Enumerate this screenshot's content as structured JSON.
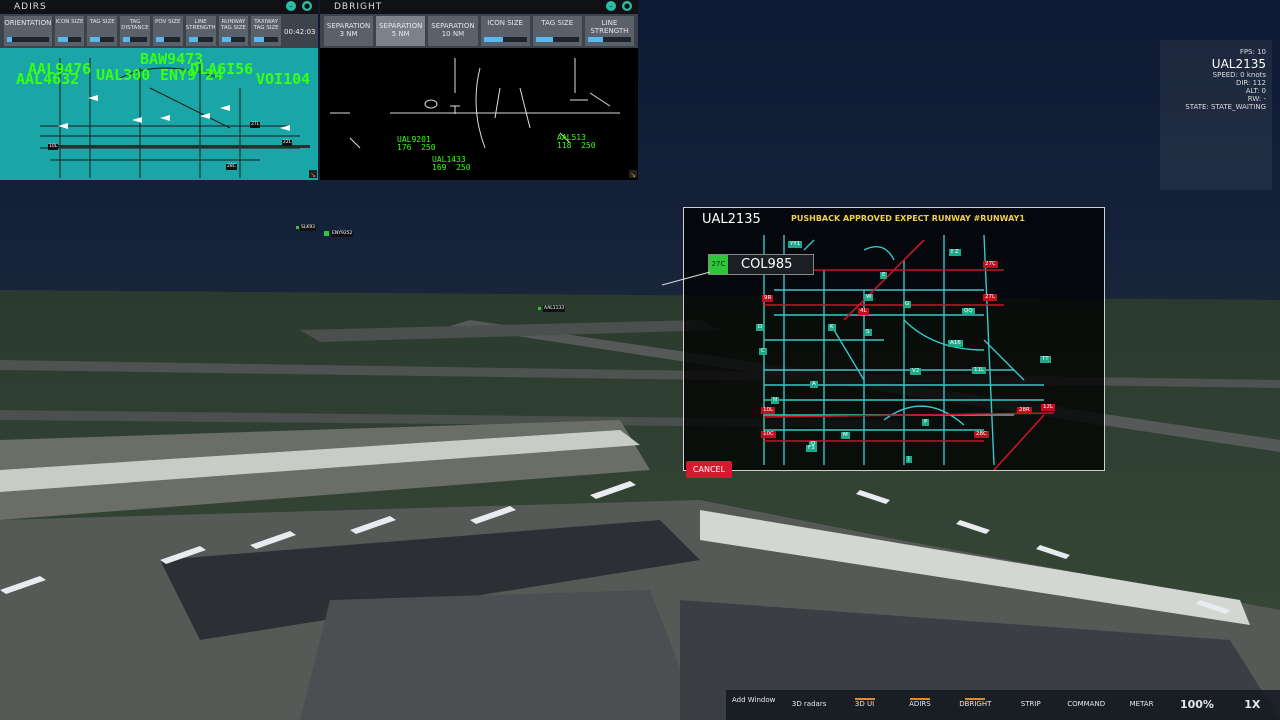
{
  "adirs": {
    "title": "ADIRS",
    "toolbar": [
      "ORIENTATION",
      "ICON SIZE",
      "TAG SIZE",
      "TAG DISTANCE",
      "POV SIZE",
      "LINE STRENGTH",
      "RUNWAY TAG SIZE",
      "TAXIWAY TAG SIZE"
    ],
    "clock": "00:42:03",
    "map_labels": {
      "a": "AAL9476",
      "b": "AAL4632",
      "c": "BAW9473",
      "d": "UAL300",
      "e": "VOI104",
      "f": "ENY9 24",
      "g": "DLA6I56"
    },
    "runways": [
      "27L",
      "10L",
      "28C",
      "22L"
    ]
  },
  "dbright": {
    "title": "DBRIGHT",
    "toolbar": {
      "sep3": "SEPARATION 3 NM",
      "sep5": "SEPARATION 5 NM",
      "sep10": "SEPARATION 10 NM",
      "icon_size": "ICON SIZE",
      "tag_size": "TAG SIZE",
      "line_strength": "LINE STRENGTH"
    },
    "targets": [
      {
        "cs": "UAL9201",
        "data": "176  250"
      },
      {
        "cs": "UAL1433",
        "data": "169  250"
      },
      {
        "cs": "AAL513",
        "data": "118  250"
      }
    ]
  },
  "stats": {
    "fps": "FPS: 10",
    "callsign": "UAL2135",
    "speed": "SPEED: 0 knots",
    "dir": "DIR: 112",
    "alt": "ALT: 0",
    "rw": "RW: -",
    "state": "STATE: STATE_WAITING"
  },
  "popup": {
    "callsign": "UAL2135",
    "message": "PUSHBACK APPROVED EXPECT RUNWAY #RUNWAY1",
    "selected_runway": "27C",
    "selected_value": "COL985",
    "cancel": "CANCEL",
    "runway_tags": [
      "27C",
      "27L",
      "9R",
      "4L",
      "10L",
      "10C",
      "28R",
      "28C",
      "12L"
    ],
    "taxi_tags": [
      "YY1",
      "B",
      "E",
      "G",
      "T",
      "A16",
      "S",
      "N",
      "Q",
      "P",
      "K",
      "A",
      "M",
      "F3",
      "QQ",
      "TT",
      "11L",
      "V2",
      "W",
      "C",
      "Z",
      "D",
      "J",
      "L"
    ]
  },
  "aircraft_tags": {
    "eny": "ENY9252",
    "tag1": "AAL1133",
    "tag2": "SLK93"
  },
  "bottom_nav": [
    {
      "label": "Add Window",
      "ul": false
    },
    {
      "label": "3D radars",
      "ul": false
    },
    {
      "label": "3D UI",
      "ul": true
    },
    {
      "label": "ADIRS",
      "ul": true
    },
    {
      "label": "DBRIGHT",
      "ul": true
    },
    {
      "label": "STRIP",
      "ul": false
    },
    {
      "label": "COMMAND",
      "ul": false
    },
    {
      "label": "METAR",
      "ul": false
    },
    {
      "label": "100%",
      "ul": false
    },
    {
      "label": "1X",
      "ul": false
    }
  ]
}
